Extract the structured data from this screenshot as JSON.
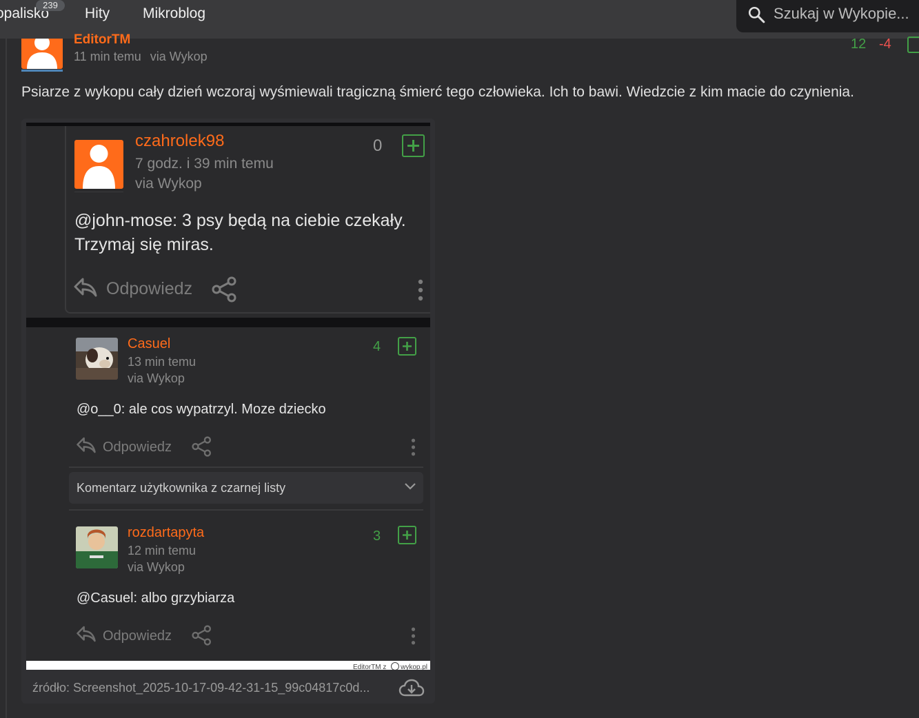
{
  "nav": {
    "items": [
      {
        "label": "opalisko",
        "badge": "239"
      },
      {
        "label": "Hity"
      },
      {
        "label": "Mikroblog"
      }
    ],
    "search_placeholder": "Szukaj w Wykopie..."
  },
  "post": {
    "author": "EditorTM",
    "time": "11 min temu",
    "via": "via Wykop",
    "votes_up": "12",
    "votes_down": "-4",
    "text": "Psiarze z wykopu cały dzień wczoraj wyśmiewali tragiczną śmierć tego człowieka. Ich to bawi. Wiedzcie z kim macie do czynienia.",
    "source": "źródło: Screenshot_2025-10-17-09-42-31-15_99c04817c0d..."
  },
  "screenshot": {
    "comments": [
      {
        "user": "czahrolek98",
        "time": "7 godz. i 39 min temu",
        "via": "via Wykop",
        "votes": "0",
        "text_line1": "@john-mose: 3 psy będą na ciebie czekały.",
        "text_line2": "Trzymaj się miras.",
        "reply": "Odpowiedz"
      },
      {
        "user": "Casuel",
        "time": "13 min temu",
        "via": "via Wykop",
        "votes": "4",
        "text_line1": "@o__0: ale cos wypatrzyl. Moze dziecko",
        "reply": "Odpowiedz"
      },
      {
        "user": "rozdartapyta",
        "time": "12 min temu",
        "via": "via Wykop",
        "votes": "3",
        "text_line1": "@Casuel: albo grzybiarza",
        "reply": "Odpowiedz"
      }
    ],
    "blacklist_label": "Komentarz użytkownika z czarnej listy",
    "watermark_user": "EditorTM",
    "watermark_z": "z",
    "watermark_site": "wykop.pl"
  },
  "colors": {
    "accent": "#ff6b1a",
    "vote_up": "#43a047",
    "vote_down": "#ef5350"
  }
}
